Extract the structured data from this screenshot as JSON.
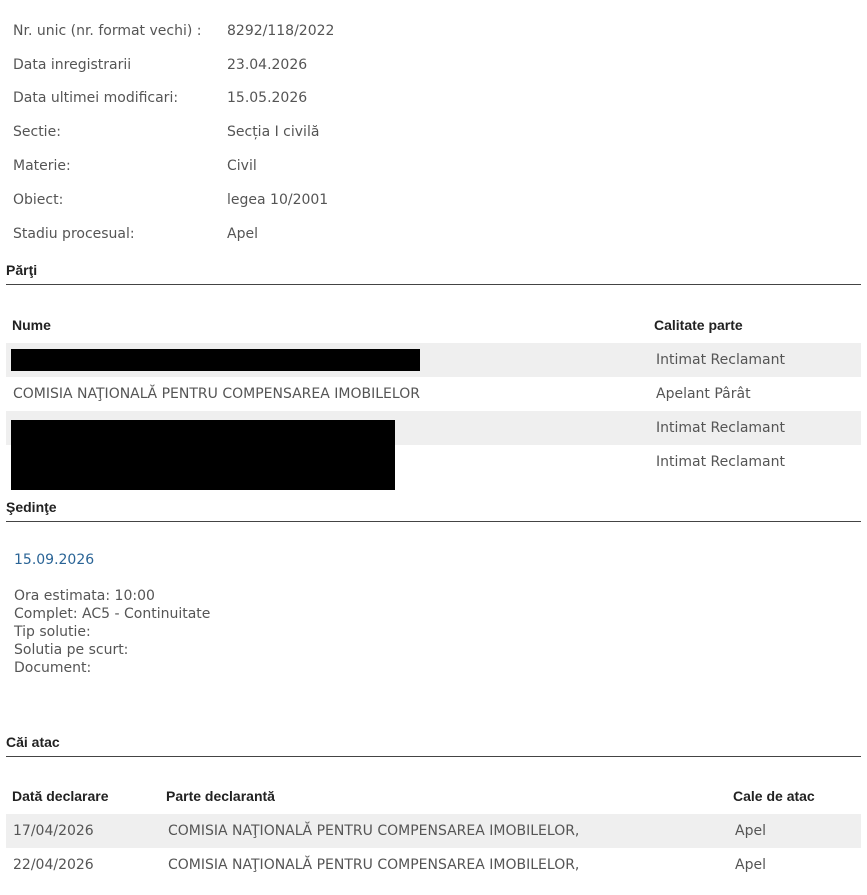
{
  "details": [
    {
      "label": "Nr. unic (nr. format vechi) :",
      "value": "8292/118/2022"
    },
    {
      "label": "Data inregistrarii",
      "value": "23.04.2026"
    },
    {
      "label": "Data ultimei modificari:",
      "value": "15.05.2026"
    },
    {
      "label": "Sectie:",
      "value": "Secția I civilă"
    },
    {
      "label": "Materie:",
      "value": "Civil"
    },
    {
      "label": "Obiect:",
      "value": "legea 10/2001"
    },
    {
      "label": "Stadiu procesual:",
      "value": "Apel"
    }
  ],
  "parti": {
    "title": "Părţi",
    "headers": {
      "nume": "Nume",
      "calitate": "Calitate parte"
    },
    "rows": [
      {
        "nume": "",
        "calitate": "Intimat Reclamant"
      },
      {
        "nume": "COMISIA NAŢIONALĂ PENTRU COMPENSAREA IMOBILELOR",
        "calitate": "Apelant Pârât"
      },
      {
        "nume": "",
        "calitate": "Intimat Reclamant"
      },
      {
        "nume": "",
        "calitate": "Intimat Reclamant"
      }
    ]
  },
  "sedinte": {
    "title": "Şedinţe",
    "date": "15.09.2026",
    "details": [
      "Ora estimata: 10:00",
      "Complet: AC5 - Continuitate",
      "Tip solutie:",
      "Solutia pe scurt:",
      "Document:"
    ]
  },
  "cai_atac": {
    "title": "Căi atac",
    "headers": {
      "data": "Dată declarare",
      "parte": "Parte declarantă",
      "cale": "Cale de atac"
    },
    "rows": [
      {
        "data": "17/04/2026",
        "parte": "COMISIA NAŢIONALĂ PENTRU COMPENSAREA IMOBILELOR,",
        "cale": "Apel"
      },
      {
        "data": "22/04/2026",
        "parte": "COMISIA NAŢIONALĂ PENTRU COMPENSAREA IMOBILELOR,",
        "cale": "Apel"
      }
    ]
  }
}
